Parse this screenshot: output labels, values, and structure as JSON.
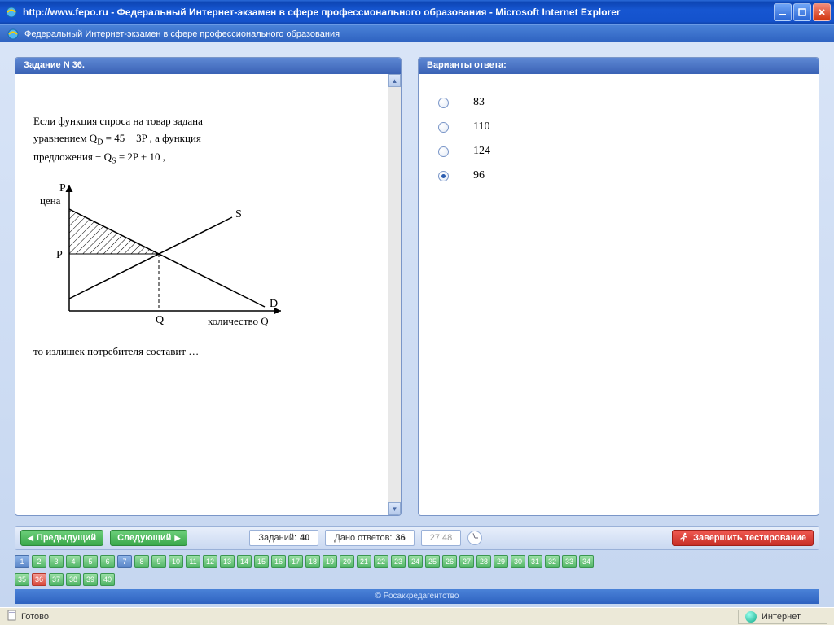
{
  "window": {
    "title": "http://www.fepo.ru - Федеральный Интернет-экзамен в сфере профессионального образования - Microsoft Internet Explorer"
  },
  "subheader": {
    "title": "Федеральный Интернет-экзамен в сфере профессионального образования"
  },
  "question_panel": {
    "header": "Задание N 36.",
    "line1": "Если функция спроса на товар задана",
    "line2_a": "уравнением Q",
    "line2_sub1": "D",
    "line2_b": " = 45 − 3P , а функция",
    "line3_a": "предложения − Q",
    "line3_sub2": "S",
    "line3_b": " = 2P + 10 ,",
    "conclusion": "то излишек потребителя составит …",
    "axis_y": "P",
    "axis_y2": "цена",
    "axis_p": "P",
    "curve_s": "S",
    "curve_d": "D",
    "axis_q": "Q",
    "axis_x": "количество Q"
  },
  "answer_panel": {
    "header": "Варианты ответа:",
    "options": [
      {
        "label": "83",
        "selected": false
      },
      {
        "label": "110",
        "selected": false
      },
      {
        "label": "124",
        "selected": false
      },
      {
        "label": "96",
        "selected": true
      }
    ]
  },
  "toolbar": {
    "prev": "Предыдущий",
    "next": "Следующий",
    "total_label": "Заданий:",
    "total_value": "40",
    "answered_label": "Дано ответов:",
    "answered_value": "36",
    "timer": "27:48",
    "finish": "Завершить тестирование"
  },
  "qgrid": {
    "total": 40,
    "answered_plain": [
      1
    ],
    "answered_green": [
      2,
      3,
      4,
      5,
      6,
      8,
      9,
      10,
      11,
      12,
      13,
      14,
      15,
      16,
      17,
      18,
      19,
      20,
      21,
      22,
      23,
      24,
      25,
      26,
      27,
      28,
      29,
      30,
      31,
      32,
      33,
      34,
      35,
      37,
      38,
      39,
      40
    ],
    "current": 36,
    "unanswered": [
      7
    ]
  },
  "footer": {
    "copyright": "© Росаккредагентство"
  },
  "statusbar": {
    "ready": "Готово",
    "zone": "Интернет"
  }
}
